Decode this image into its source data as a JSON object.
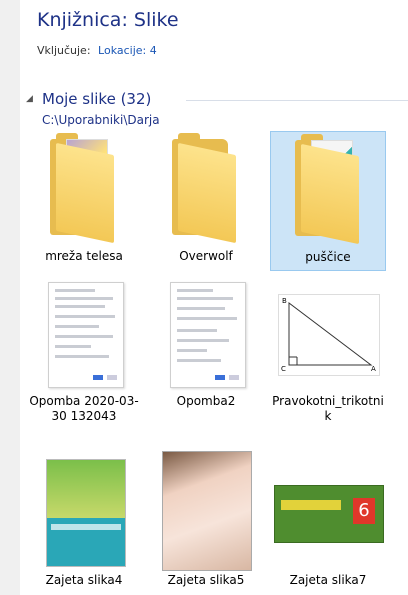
{
  "library": {
    "title": "Knjižnica: Slike",
    "includes_label": "Vključuje:",
    "locations_link": "Lokacije: 4"
  },
  "group": {
    "title": "Moje slike (32)",
    "path": "C:\\Uporabniki\\Darja"
  },
  "items": [
    {
      "name": "mreža telesa",
      "type": "folder",
      "icon": "folder-icon"
    },
    {
      "name": "Overwolf",
      "type": "folder",
      "icon": "folder-icon"
    },
    {
      "name": "puščice",
      "type": "folder",
      "icon": "folder-icon",
      "selected": true
    },
    {
      "name": "Opomba 2020-03-30 132043",
      "type": "image",
      "icon": "document-thumbnail"
    },
    {
      "name": "Opomba2",
      "type": "image",
      "icon": "document-thumbnail"
    },
    {
      "name": "Pravokotni_trikotnik",
      "type": "image",
      "icon": "triangle-thumbnail"
    },
    {
      "name": "Zajeta slika4",
      "type": "image",
      "icon": "book-thumbnail"
    },
    {
      "name": "Zajeta slika5",
      "type": "image",
      "icon": "photo-thumbnail"
    },
    {
      "name": "Zajeta slika7",
      "type": "image",
      "icon": "cover-thumbnail"
    }
  ],
  "colors": {
    "title": "#1e3287",
    "link": "#1a56b5",
    "selection": "#cce4f7",
    "folder": "#f3c856"
  }
}
